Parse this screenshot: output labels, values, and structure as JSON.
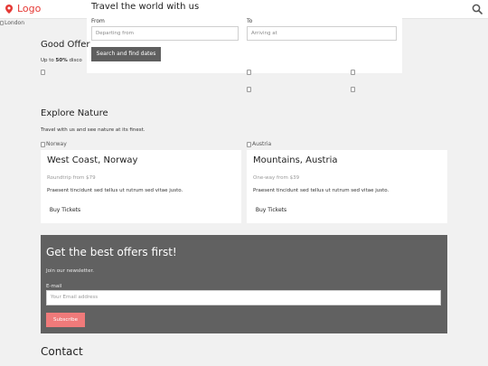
{
  "header": {
    "logo_label": "Logo",
    "accent_color": "#e53935",
    "search_icon": "search-icon",
    "marker_icon": "map-marker-icon"
  },
  "hero": {
    "image_alt": "London"
  },
  "booking": {
    "title": "Travel the world with us",
    "from_label": "From",
    "from_placeholder": "Departing from",
    "to_label": "To",
    "to_placeholder": "Arriving at",
    "search_button": "Search and find dates"
  },
  "offers": {
    "title": "Good Offers",
    "title_visible": "Good Offer",
    "subtitle_prefix": "Up to ",
    "subtitle_bold": "50%",
    "subtitle_suffix": " disco",
    "image_alts": [
      "",
      "",
      "",
      "",
      ""
    ]
  },
  "explore": {
    "title": "Explore Nature",
    "subtitle": "Travel with us and see nature at its finest.",
    "cards": [
      {
        "image_alt": "Norway",
        "title": "West Coast, Norway",
        "price": "Roundtrip from $79",
        "description": "Praesent tincidunt sed tellus ut rutrum sed vitae justo.",
        "button": "Buy Tickets"
      },
      {
        "image_alt": "Austria",
        "title": "Mountains, Austria",
        "price": "One-way from $39",
        "description": "Praesent tincidunt sed tellus ut rutrum sed vitae justo.",
        "button": "Buy Tickets"
      }
    ]
  },
  "newsletter": {
    "title": "Get the best offers first!",
    "subtitle": "Join our newsletter.",
    "email_label": "E-mail",
    "email_placeholder": "Your Email address",
    "subscribe_button": "Subscribe",
    "bg_color": "#616161",
    "button_color": "#f07a7a"
  },
  "contact": {
    "title": "Contact"
  }
}
